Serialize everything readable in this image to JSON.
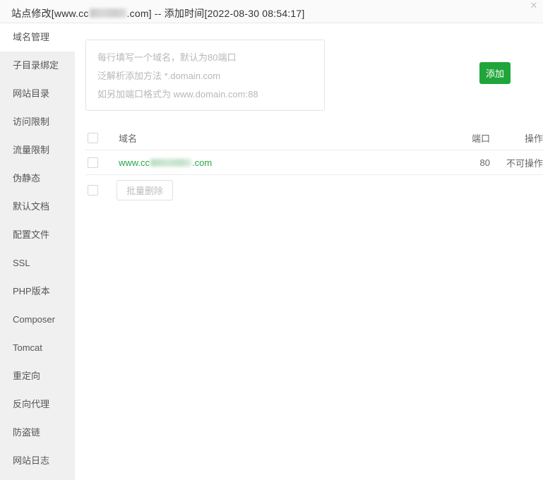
{
  "window": {
    "title_prefix": "站点修改[www.cc",
    "title_suffix": ".com] -- 添加时间[2022-08-30 08:54:17]",
    "close_icon": "✕",
    "accent_color": "#20a53a",
    "link_color": "#27a745"
  },
  "sidebar": {
    "items": [
      {
        "label": "域名管理",
        "active": true
      },
      {
        "label": "子目录绑定",
        "active": false
      },
      {
        "label": "网站目录",
        "active": false
      },
      {
        "label": "访问限制",
        "active": false
      },
      {
        "label": "流量限制",
        "active": false
      },
      {
        "label": "伪静态",
        "active": false
      },
      {
        "label": "默认文档",
        "active": false
      },
      {
        "label": "配置文件",
        "active": false
      },
      {
        "label": "SSL",
        "active": false
      },
      {
        "label": "PHP版本",
        "active": false
      },
      {
        "label": "Composer",
        "active": false
      },
      {
        "label": "Tomcat",
        "active": false
      },
      {
        "label": "重定向",
        "active": false
      },
      {
        "label": "反向代理",
        "active": false
      },
      {
        "label": "防盗链",
        "active": false
      },
      {
        "label": "网站日志",
        "active": false
      }
    ]
  },
  "add_form": {
    "textarea_placeholder": "每行填写一个域名，默认为80端口\n泛解析添加方法 *.domain.com\n如另加端口格式为 www.domain.com:88",
    "textarea_value": "",
    "add_button_label": "添加"
  },
  "table": {
    "headers": {
      "domain": "域名",
      "port": "端口",
      "operation": "操作"
    },
    "rows": [
      {
        "domain_prefix": "www.cc",
        "domain_suffix": ".com",
        "port": "80",
        "operation": "不可操作",
        "checked": false
      }
    ]
  },
  "batch": {
    "delete_label": "批量删除",
    "checked": false
  }
}
